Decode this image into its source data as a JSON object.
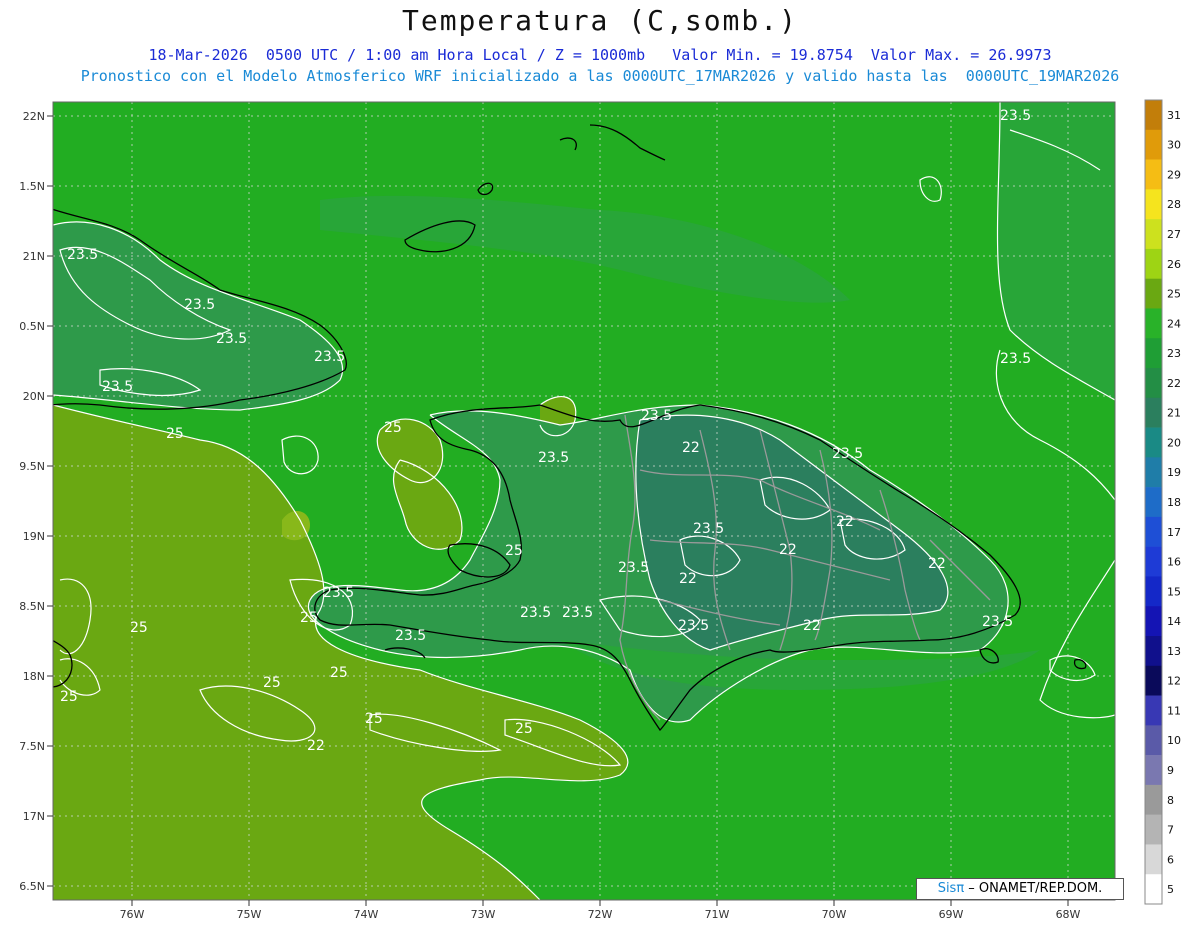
{
  "header": {
    "title": "Temperatura (C,somb.)",
    "subtitle_1": "18-Mar-2026  0500 UTC / 1:00 am Hora Local / Z = 1000mb   Valor Min. = 19.8754  Valor Max. = 26.9973",
    "subtitle_2": "Pronostico con el Modelo Atmosferico WRF inicializado a las 0000UTC_17MAR2026 y valido hasta las  0000UTC_19MAR2026"
  },
  "map": {
    "lat_ticks": [
      "22N",
      "1.5N",
      "21N",
      "0.5N",
      "20N",
      "9.5N",
      "19N",
      "8.5N",
      "18N",
      "7.5N",
      "17N",
      "6.5N"
    ],
    "lon_ticks": [
      "76W",
      "75W",
      "74W",
      "73W",
      "72W",
      "71W",
      "70W",
      "69W",
      "68W"
    ],
    "contour_labels": [
      {
        "text": "23.5"
      },
      {
        "text": "23.5"
      },
      {
        "text": "23.5"
      },
      {
        "text": "23.5"
      },
      {
        "text": "23.5"
      },
      {
        "text": "23.5"
      },
      {
        "text": "23.5"
      },
      {
        "text": "23.5"
      },
      {
        "text": "23.5"
      },
      {
        "text": "23.5"
      },
      {
        "text": "23.5"
      },
      {
        "text": "23.5"
      },
      {
        "text": "23.5"
      },
      {
        "text": "23.5"
      },
      {
        "text": "23.5"
      },
      {
        "text": "23.5"
      },
      {
        "text": "23.5"
      },
      {
        "text": "23.5"
      },
      {
        "text": "25"
      },
      {
        "text": "25"
      },
      {
        "text": "25"
      },
      {
        "text": "25"
      },
      {
        "text": "25"
      },
      {
        "text": "25"
      },
      {
        "text": "25"
      },
      {
        "text": "25"
      },
      {
        "text": "25"
      },
      {
        "text": "25"
      },
      {
        "text": "22"
      },
      {
        "text": "22"
      },
      {
        "text": "22"
      },
      {
        "text": "22"
      },
      {
        "text": "22"
      },
      {
        "text": "22"
      },
      {
        "text": "22"
      }
    ],
    "colors": {
      "field_base": "#22ad22",
      "field_warm": "#6aa812",
      "field_cool": "#2e9a4a",
      "field_cold": "#2b7f5e"
    }
  },
  "colorbar": {
    "labels": [
      "31",
      "30",
      "29",
      "28",
      "27",
      "26",
      "25",
      "24",
      "23",
      "22",
      "21",
      "20",
      "19",
      "18",
      "17",
      "16",
      "15",
      "14",
      "13",
      "12",
      "11",
      "10",
      "9",
      "8",
      "7",
      "6",
      "5"
    ],
    "colors": [
      "#c27e0a",
      "#e09b0a",
      "#f5bd14",
      "#f5e41e",
      "#cde11e",
      "#9ed414",
      "#6aa812",
      "#29b229",
      "#1f9e35",
      "#238e45",
      "#2b7f5e",
      "#1a8a85",
      "#1f7da8",
      "#1e6cc8",
      "#1e4fd6",
      "#1e3bd6",
      "#1428c8",
      "#1414b4",
      "#10108c",
      "#0a0a5a",
      "#3838b4",
      "#5a5aa8",
      "#7a78b0",
      "#9a9a9a",
      "#b4b4b4",
      "#d8d8d8",
      "#ffffff"
    ]
  },
  "credit": {
    "logo": "Sisπ",
    "text": " –  ONAMET/REP.DOM."
  }
}
